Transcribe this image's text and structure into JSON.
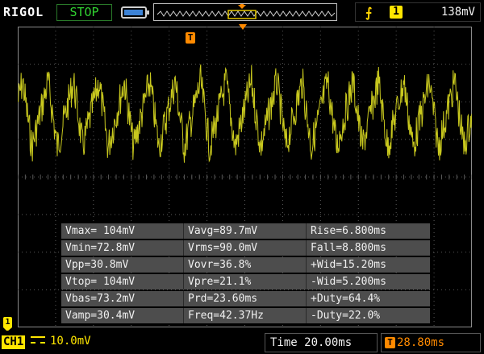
{
  "topbar": {
    "brand": "RIGOL",
    "run_state": "STOP",
    "trigger_edge_glyph": "⨍",
    "trigger_source": "1",
    "trigger_level": "138mV"
  },
  "screen": {
    "trigger_marker_label": "T"
  },
  "measurements": {
    "rows": [
      [
        "Vmax= 104mV",
        "Vavg=89.7mV",
        "Rise=6.800ms"
      ],
      [
        "Vmin=72.8mV",
        "Vrms=90.0mV",
        "Fall=8.800ms"
      ],
      [
        "Vpp=30.8mV",
        "Vovr=36.8%",
        "+Wid=15.20ms"
      ],
      [
        "Vtop= 104mV",
        "Vpre=21.1%",
        "-Wid=5.200ms"
      ],
      [
        "Vbas=73.2mV",
        "Prd=23.60ms",
        "+Duty=64.4%"
      ],
      [
        "Vamp=30.4mV",
        "Freq=42.37Hz",
        "-Duty=22.0%"
      ]
    ]
  },
  "bottombar": {
    "channel_label": "CH1",
    "channel_scale": "10.0mV",
    "timebase": "Time 20.00ms",
    "trigger_offset": "28.80ms",
    "trigger_offset_icon": "T"
  },
  "colors": {
    "trace": "#c8c81e",
    "grid": "#5a5a5a",
    "channel": "#ffe600",
    "trigger": "#ff8a00",
    "run_state": "#31d331"
  },
  "icons": [
    "battery-icon",
    "memory-waveform-icon",
    "trigger-edge-icon",
    "channel-coupling-icon",
    "trigger-position-icon"
  ]
}
